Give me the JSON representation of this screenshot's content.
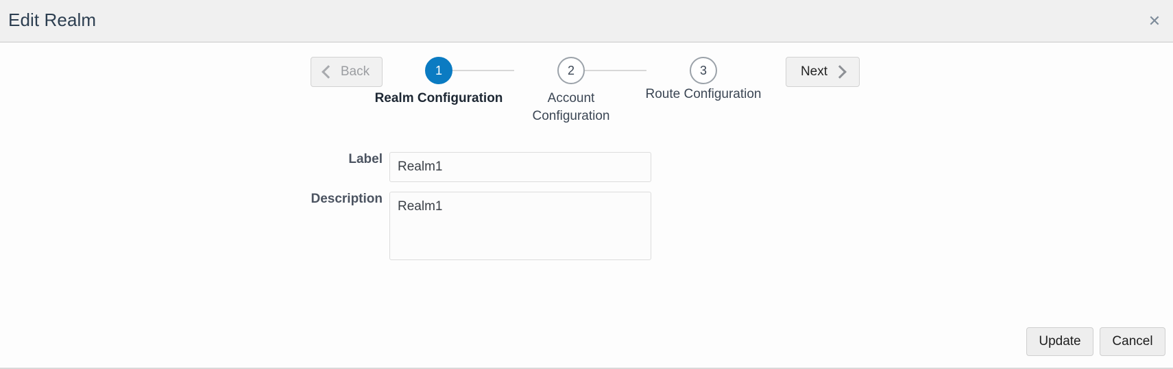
{
  "header": {
    "title": "Edit Realm",
    "close_icon": "close-icon",
    "close_glyph": "✕"
  },
  "stepper": {
    "back_button": {
      "label": "Back",
      "icon": "chevron-left-icon",
      "disabled": true
    },
    "next_button": {
      "label": "Next",
      "icon": "chevron-right-icon",
      "disabled": false
    },
    "active_color": "#0b7bc2",
    "inactive_color": "#9ba2a9",
    "connector_color": "#d7d7d7",
    "steps": [
      {
        "number": "1",
        "label": "Realm Configuration",
        "state": "active"
      },
      {
        "number": "2",
        "label": "Account Configuration",
        "state": "inactive"
      },
      {
        "number": "3",
        "label": "Route Configuration",
        "state": "inactive"
      }
    ]
  },
  "form": {
    "fields": [
      {
        "label": "Label",
        "value": "Realm1",
        "placeholder": "",
        "type": "text"
      },
      {
        "label": "Description",
        "value": "Realm1",
        "placeholder": "",
        "type": "textarea"
      }
    ]
  },
  "footer": {
    "update_label": "Update",
    "cancel_label": "Cancel"
  }
}
